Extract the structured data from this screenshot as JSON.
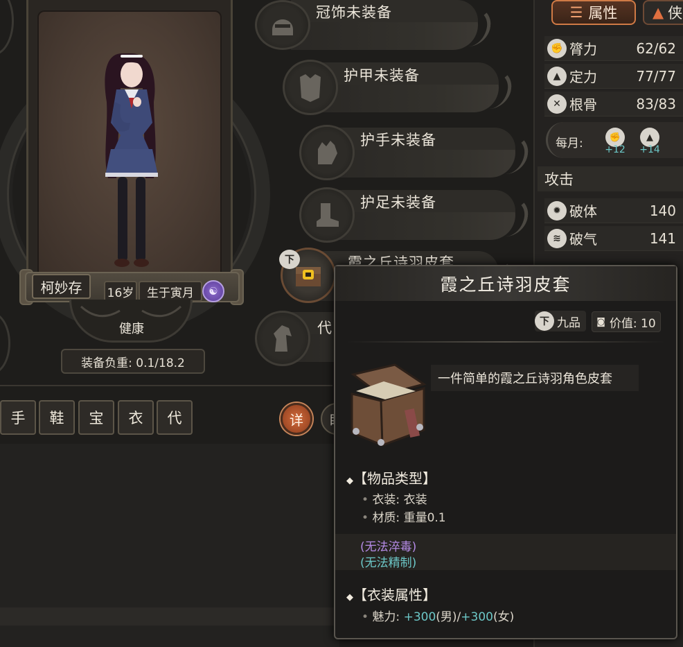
{
  "character": {
    "name": "柯妙存",
    "age": "16岁",
    "birth": "生于寅月",
    "zodiac_glyph": "☯",
    "health": "健康",
    "load": "装备负重: 0.1/18.2"
  },
  "category_tabs": [
    "手",
    "鞋",
    "宝",
    "衣",
    "代"
  ],
  "detail_button": "详",
  "other_button": "眼",
  "slots": [
    {
      "label": "冠饰未装备",
      "icon": "helmet-icon"
    },
    {
      "label": "护甲未装备",
      "icon": "armor-icon"
    },
    {
      "label": "护手未装备",
      "icon": "gauntlet-icon"
    },
    {
      "label": "护足未装备",
      "icon": "boot-icon"
    },
    {
      "label": "霞之丘诗羽皮套",
      "icon": "costume-chest-icon"
    },
    {
      "label": "代",
      "icon": "horse-icon"
    }
  ],
  "down_badge": "下",
  "right_panel": {
    "tab_active": "属性",
    "tab_other": "侠",
    "stats": [
      {
        "name": "膂力",
        "value": "62/62",
        "icon": "strength-icon"
      },
      {
        "name": "定力",
        "value": "77/77",
        "icon": "focus-icon"
      },
      {
        "name": "根骨",
        "value": "83/83",
        "icon": "bone-icon"
      }
    ],
    "monthly_label": "每月:",
    "monthly": [
      "+12",
      "+14"
    ],
    "attack_header": "攻击",
    "attack_stats": [
      {
        "name": "破体",
        "value": "140",
        "icon": "break-body-icon"
      },
      {
        "name": "破气",
        "value": "141",
        "icon": "break-qi-icon"
      }
    ]
  },
  "tooltip": {
    "title": "霞之丘诗羽皮套",
    "grade": "九品",
    "value": "价值: 10",
    "description": "一件简单的霞之丘诗羽角色皮套",
    "section1": "【物品类型】",
    "type_line": "衣装: 衣装",
    "material_line": "材质: 重量0.1",
    "no_poison": "(无法淬毒)",
    "no_refine": "(无法精制)",
    "section2": "【衣装属性】",
    "charm_prefix": "魅力: ",
    "charm_male": "+300",
    "charm_male_suffix": "(男)/",
    "charm_female": "+300",
    "charm_female_suffix": "(女)"
  },
  "colors": {
    "accent_orange": "#d07a45",
    "cyan": "#6cc7c7",
    "purple": "#b58be6"
  }
}
